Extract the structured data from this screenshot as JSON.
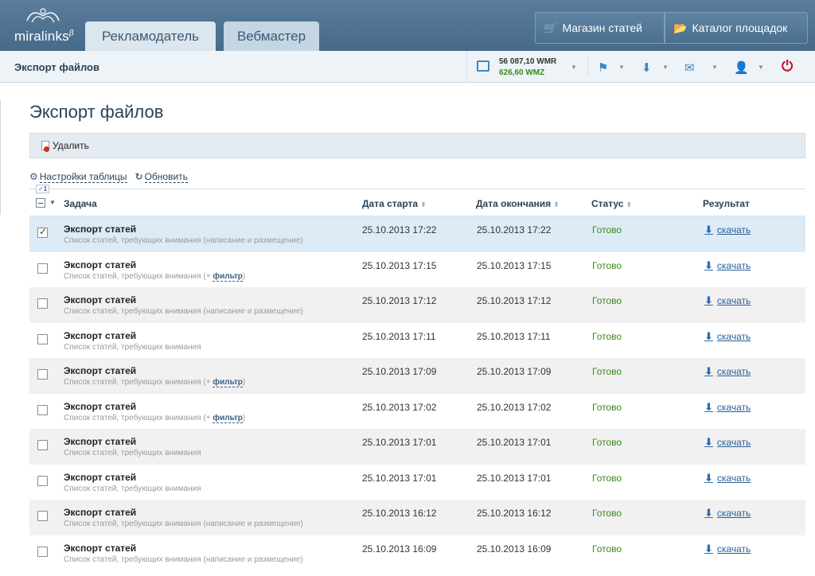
{
  "header": {
    "logo_text": "miralinks",
    "logo_sup": "β",
    "tabs": [
      {
        "label": "Рекламодатель"
      },
      {
        "label": "Вебмастер"
      }
    ],
    "buttons": {
      "shop": "Магазин статей",
      "catalog": "Каталог площадок"
    }
  },
  "subheader": {
    "title": "Экспорт файлов",
    "wallet": {
      "wmr": "56 087,10 WMR",
      "wmz": "626,60 WMZ"
    },
    "icons": [
      "flag-icon",
      "download-icon",
      "mail-icon",
      "user-icon",
      "power-icon"
    ]
  },
  "page": {
    "title": "Экспорт файлов",
    "delete_label": "Удалить",
    "settings_label": "Настройки таблицы",
    "refresh_label": "Обновить",
    "header_badge": "✓1"
  },
  "table": {
    "columns": {
      "task": "Задача",
      "start": "Дата старта",
      "end": "Дата окончания",
      "status": "Статус",
      "result": "Результат"
    },
    "rows": [
      {
        "task": "Экспорт статей",
        "desc": "Список статей, требующих внимания (написание и размещение)",
        "filter": "",
        "start": "25.10.2013 17:22",
        "end": "25.10.2013 17:22",
        "status": "Готово",
        "result": "скачать",
        "checked": true
      },
      {
        "task": "Экспорт статей",
        "desc": "Список статей, требующих внимания (+ ",
        "filter": "фильтр",
        "start": "25.10.2013 17:15",
        "end": "25.10.2013 17:15",
        "status": "Готово",
        "result": "скачать",
        "checked": false
      },
      {
        "task": "Экспорт статей",
        "desc": "Список статей, требующих внимания (написание и размещение)",
        "filter": "",
        "start": "25.10.2013 17:12",
        "end": "25.10.2013 17:12",
        "status": "Готово",
        "result": "скачать",
        "checked": false
      },
      {
        "task": "Экспорт статей",
        "desc": "Список статей, требующих внимания",
        "filter": "",
        "start": "25.10.2013 17:11",
        "end": "25.10.2013 17:11",
        "status": "Готово",
        "result": "скачать",
        "checked": false
      },
      {
        "task": "Экспорт статей",
        "desc": "Список статей, требующих внимания (+ ",
        "filter": "фильтр",
        "start": "25.10.2013 17:09",
        "end": "25.10.2013 17:09",
        "status": "Готово",
        "result": "скачать",
        "checked": false
      },
      {
        "task": "Экспорт статей",
        "desc": "Список статей, требующих внимания (+ ",
        "filter": "фильтр",
        "start": "25.10.2013 17:02",
        "end": "25.10.2013 17:02",
        "status": "Готово",
        "result": "скачать",
        "checked": false
      },
      {
        "task": "Экспорт статей",
        "desc": "Список статей, требующих внимания",
        "filter": "",
        "start": "25.10.2013 17:01",
        "end": "25.10.2013 17:01",
        "status": "Готово",
        "result": "скачать",
        "checked": false
      },
      {
        "task": "Экспорт статей",
        "desc": "Список статей, требующих внимания",
        "filter": "",
        "start": "25.10.2013 17:01",
        "end": "25.10.2013 17:01",
        "status": "Готово",
        "result": "скачать",
        "checked": false
      },
      {
        "task": "Экспорт статей",
        "desc": "Список статей, требующих внимания (написание и размещение)",
        "filter": "",
        "start": "25.10.2013 16:12",
        "end": "25.10.2013 16:12",
        "status": "Готово",
        "result": "скачать",
        "checked": false
      },
      {
        "task": "Экспорт статей",
        "desc": "Список статей, требующих внимания (написание и размещение)",
        "filter": "",
        "start": "25.10.2013 16:09",
        "end": "25.10.2013 16:09",
        "status": "Готово",
        "result": "скачать",
        "checked": false
      }
    ]
  },
  "colors": {
    "accent": "#476a8a",
    "status_ok": "#3a8a1e",
    "link": "#2b5f95"
  }
}
